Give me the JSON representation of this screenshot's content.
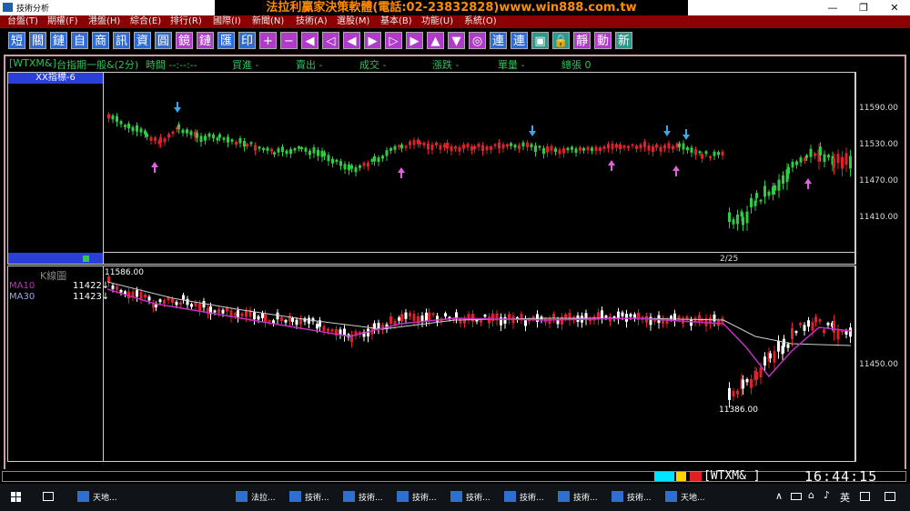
{
  "window": {
    "title": "技術分析",
    "ad": "法拉利贏家決策軟體(電話:02-23832828)www.win888.com.tw"
  },
  "menu": [
    "台盤(T)",
    "期權(F)",
    "港盤(H)",
    "綜合(E)",
    "排行(R)",
    "國際(I)",
    "新聞(N)",
    "技術(A)",
    "選股(M)",
    "基本(B)",
    "功能(U)",
    "系統(O)"
  ],
  "toolbar": [
    {
      "label": "短",
      "color": "#2e6bd6"
    },
    {
      "label": "關",
      "color": "#2e6bd6"
    },
    {
      "label": "鏈",
      "color": "#2e6bd6"
    },
    {
      "label": "自",
      "color": "#2e6bd6"
    },
    {
      "label": "商",
      "color": "#2e6bd6"
    },
    {
      "label": "訊",
      "color": "#2e6bd6"
    },
    {
      "label": "資",
      "color": "#2e6bd6"
    },
    {
      "label": "圓",
      "color": "#2e6bd6"
    },
    {
      "label": "鏡",
      "color": "#b03ac9"
    },
    {
      "label": "鏈",
      "color": "#b03ac9"
    },
    {
      "label": "匯",
      "color": "#2e6bd6"
    },
    {
      "label": "印",
      "color": "#2e6bd6"
    },
    {
      "label": "+",
      "color": "#b03ac9"
    },
    {
      "label": "−",
      "color": "#b03ac9"
    },
    {
      "label": "◀",
      "color": "#b03ac9"
    },
    {
      "label": "◁",
      "color": "#b03ac9"
    },
    {
      "label": "◀",
      "color": "#b03ac9"
    },
    {
      "label": "▶",
      "color": "#b03ac9"
    },
    {
      "label": "▷",
      "color": "#b03ac9"
    },
    {
      "label": "▶",
      "color": "#b03ac9"
    },
    {
      "label": "▲",
      "color": "#b03ac9"
    },
    {
      "label": "▼",
      "color": "#b03ac9"
    },
    {
      "label": "◎",
      "color": "#b03ac9"
    },
    {
      "label": "連",
      "color": "#2e6bd6"
    },
    {
      "label": "連",
      "color": "#2e6bd6"
    },
    {
      "label": "▣",
      "color": "#2a9a8a"
    },
    {
      "label": "🔒",
      "color": "#2a9a8a"
    },
    {
      "label": "靜",
      "color": "#b03ac9"
    },
    {
      "label": "動",
      "color": "#b03ac9"
    },
    {
      "label": "新",
      "color": "#2a9a8a"
    }
  ],
  "info": {
    "symbol": "[WTXM&]",
    "name": "台指期一般&(2分)",
    "time": "時間 --:--:--",
    "buy": "買進 -",
    "sell": "賣出 -",
    "deal": "成交 -",
    "change": "漲跌 -",
    "volume": "單量 -",
    "total": "總張 0"
  },
  "top_panel": {
    "label": "XX指標-6",
    "y_labels": [
      "11590.00",
      "11530.00",
      "11470.00",
      "11410.00"
    ],
    "date": "2/25"
  },
  "bottom_panel": {
    "label": "K線圖",
    "high_label": "11586.00",
    "low_label": "11386.00",
    "ma10_label": "MA10",
    "ma10_value": "11422↓",
    "ma30_label": "MA30",
    "ma30_value": "11423↓",
    "y_label": "11450.00"
  },
  "status": {
    "symbol": "[WTXM&  ]",
    "clock": "16:44:15"
  },
  "taskbar": [
    {
      "label": "天地..."
    },
    {
      "label": "法拉..."
    },
    {
      "label": "技術..."
    },
    {
      "label": "技術..."
    },
    {
      "label": "技術..."
    },
    {
      "label": "技術..."
    },
    {
      "label": "技術..."
    },
    {
      "label": "技術..."
    },
    {
      "label": "技術..."
    },
    {
      "label": "天地..."
    }
  ],
  "tray": {
    "lang": "英"
  },
  "colors": {
    "up": "#e0202a",
    "down": "#ffffff",
    "green": "#2ecc40",
    "ma10": "#c030c0",
    "ma30": "#c8d0d0",
    "arrow_down": "#3aa8e8",
    "arrow_up": "#e060e0"
  }
}
